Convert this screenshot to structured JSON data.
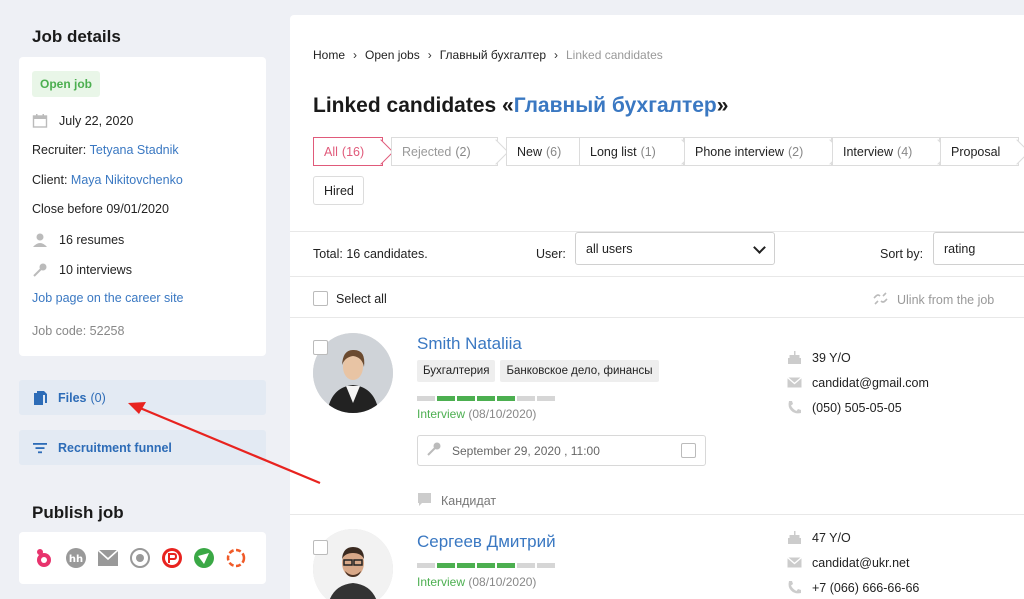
{
  "sidebar": {
    "job_details_title": "Job details",
    "status": "Open job",
    "date": "July 22, 2020",
    "recruiter_label": "Recruiter:",
    "recruiter_name": "Tetyana Stadnik",
    "client_label": "Client:",
    "client_name": "Maya Nikitovchenko",
    "close_before": "Close before 09/01/2020",
    "resumes": "16 resumes",
    "interviews": "10 interviews",
    "career_link": "Job page on the career site",
    "job_code": "Job code: 52258",
    "files_label": "Files",
    "files_count": "(0)",
    "funnel_label": "Recruitment funnel",
    "publish_title": "Publish job"
  },
  "breadcrumb": {
    "home": "Home",
    "open_jobs": "Open jobs",
    "job": "Главный бухгалтер",
    "current": "Linked candidates"
  },
  "heading": {
    "prefix": "Linked candidates «",
    "job": "Главный бухгалтер",
    "suffix": "»"
  },
  "filters": [
    {
      "label": "All",
      "count": "(16)"
    },
    {
      "label": "Rejected",
      "count": "(2)"
    },
    {
      "label": "New",
      "count": "(6)"
    },
    {
      "label": "Long list",
      "count": "(1)"
    },
    {
      "label": "Phone interview",
      "count": "(2)"
    },
    {
      "label": "Interview",
      "count": "(4)"
    },
    {
      "label": "Proposal",
      "count": ""
    },
    {
      "label": "Hired",
      "count": ""
    }
  ],
  "toolbar": {
    "total": "Total: 16 candidates.",
    "user_label": "User:",
    "user_value": "all users",
    "sort_label": "Sort by:",
    "sort_value": "rating"
  },
  "select_all": "Select all",
  "unlink": "Ulink from the job",
  "candidates": [
    {
      "name": "Smith Nataliia",
      "tags": [
        "Бухгалтерия",
        "Банковское дело, финансы"
      ],
      "stage": "Interview",
      "stage_date": "(08/10/2020)",
      "stage_progress": 0.57,
      "event": "September 29, 2020 , 11:00",
      "note": "Кандидат",
      "age": "39 Y/O",
      "email": "candidat@gmail.com",
      "phone": "(050) 505-05-05"
    },
    {
      "name": "Сергеев Дмитрий",
      "stage": "Interview",
      "stage_date": "(08/10/2020)",
      "stage_progress": 0.57,
      "age": "47 Y/O",
      "email": "candidat@ukr.net",
      "phone": "+7 (066) 666-66-66"
    }
  ],
  "colors": {
    "accent": "#3a78c2",
    "active_filter": "#e05a7a",
    "success": "#4caf50",
    "annotation_arrow": "#e8231f"
  }
}
